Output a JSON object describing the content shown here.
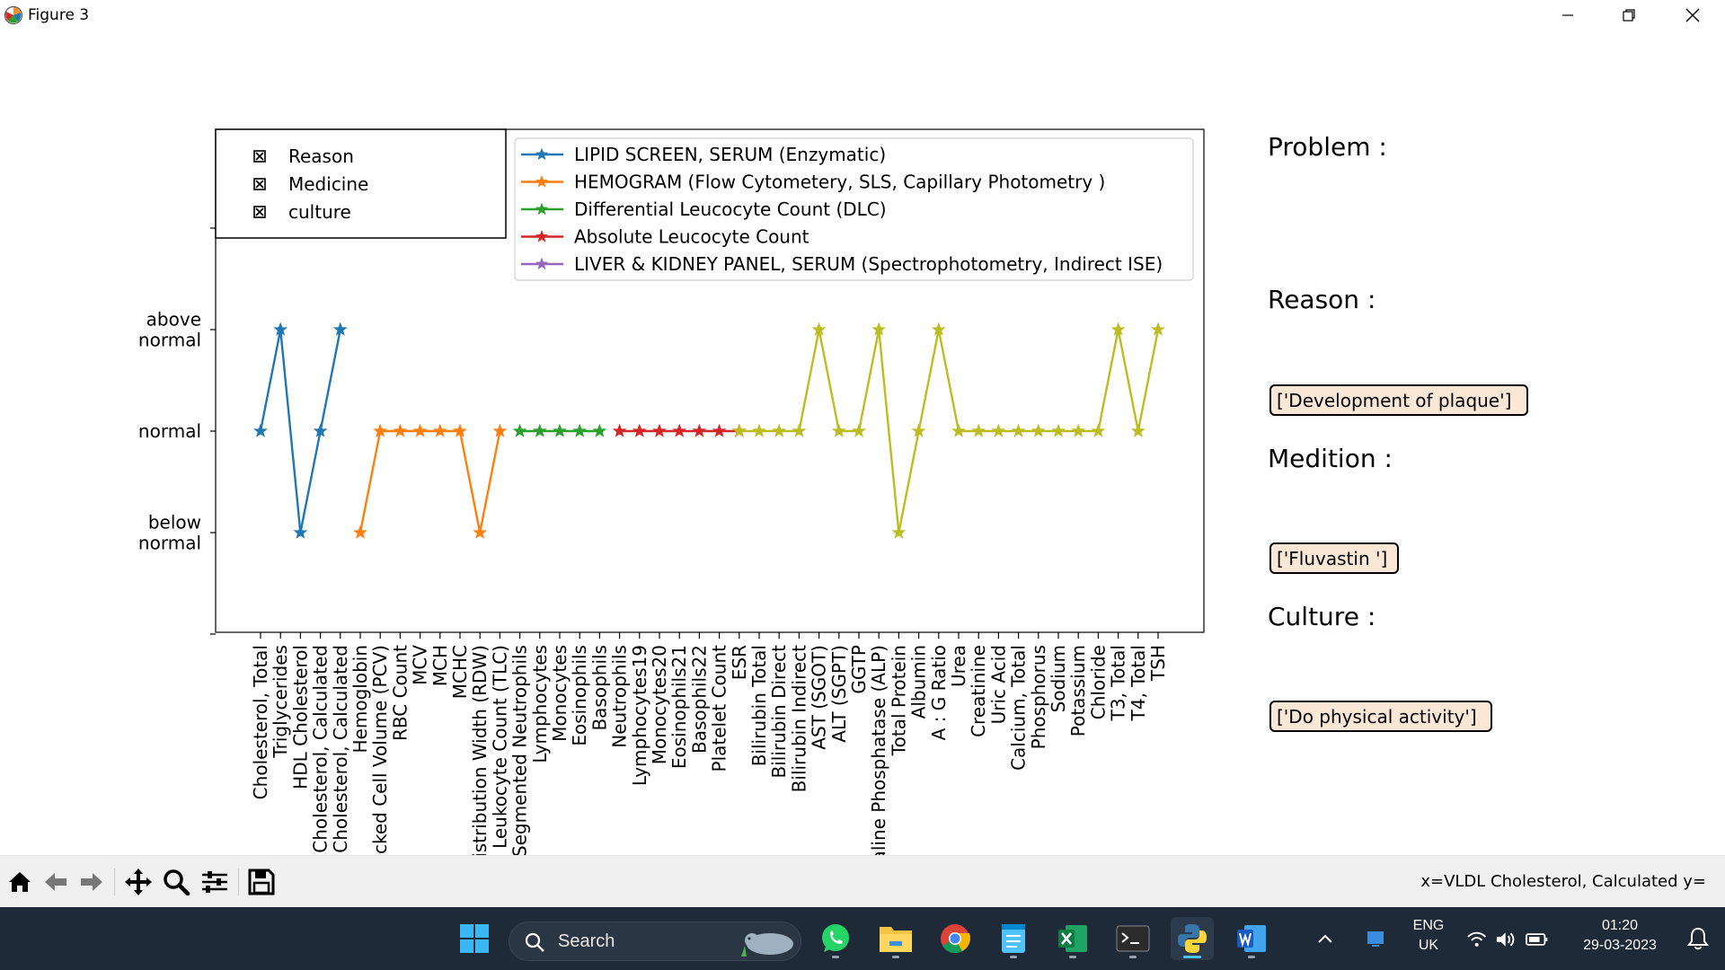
{
  "window": {
    "title": "Figure 3"
  },
  "chart_data": {
    "type": "line",
    "ylim": [
      -2,
      2
    ],
    "y_ticks": [
      {
        "value": -1,
        "label": "below\nnormal"
      },
      {
        "value": 0,
        "label": "normal"
      },
      {
        "value": 1,
        "label": "above\nnormal"
      }
    ],
    "categories": [
      "Cholesterol, Total",
      "Triglycerides",
      "HDL Cholesterol",
      "LDL Cholesterol, Calculated",
      "VLDL Cholesterol, Calculated",
      "Hemoglobin",
      "Packed Cell Volume (PCV)",
      "RBC Count",
      "MCV",
      "MCH",
      "MCHC",
      "Red Cell Distribution Width (RDW)",
      "Total Leukocyte Count (TLC)",
      "Segmented Neutrophils",
      "Lymphocytes",
      "Monocytes",
      "Eosinophils",
      "Basophils",
      "Neutrophils",
      "Lymphocytes19",
      "Monocytes20",
      "Eosinophils21",
      "Basophils22",
      "Platelet Count",
      "ESR",
      "Bilirubin Total",
      "Bilirubin Direct",
      "Bilirubin Indirect",
      "AST (SGOT)",
      "ALT (SGPT)",
      "GGTP",
      "Alkaline Phosphatase (ALP)",
      "Total Protein",
      "Albumin",
      "A : G Ratio",
      "Urea",
      "Creatinine",
      "Uric Acid",
      "Calcium, Total",
      "Phosphorus",
      "Sodium",
      "Potassium",
      "Chloride",
      "T3, Total",
      "T4, Total",
      "TSH"
    ],
    "series": [
      {
        "name": "LIPID SCREEN, SERUM (Enzymatic)",
        "color": "#1f77b4",
        "start": 0,
        "values": [
          0,
          1,
          -1,
          0,
          1
        ]
      },
      {
        "name": "HEMOGRAM (Flow Cytometery, SLS, Capillary Photometry )",
        "color": "#ff7f0e",
        "start": 5,
        "values": [
          -1,
          0,
          0,
          0,
          0,
          0,
          -1,
          0
        ]
      },
      {
        "name": "Differential Leucocyte Count (DLC)",
        "color": "#2ca02c",
        "start": 13,
        "values": [
          0,
          0,
          0,
          0,
          0
        ]
      },
      {
        "name": "Absolute Leucocyte Count",
        "color": "#d62728",
        "start": 18,
        "values": [
          0,
          0,
          0,
          0,
          0,
          0,
          0
        ]
      },
      {
        "name": "LIVER & KIDNEY PANEL, SERUM (Spectrophotometry, Indirect ISE)",
        "color": "#9467bd",
        "start": 25,
        "values": []
      },
      {
        "name": "",
        "color": "#bcbd22",
        "start": 24,
        "values": [
          0,
          0,
          0,
          0,
          1,
          0,
          0,
          1,
          -1,
          0,
          1,
          0,
          0,
          0,
          0,
          0,
          0,
          0,
          0,
          1,
          0,
          1
        ]
      }
    ],
    "legend_box": [
      "Reason",
      "Medicine",
      "culture"
    ],
    "legend_placement": "top"
  },
  "side_panel": {
    "problem_label": "Problem :",
    "reason_label": "Reason :",
    "reason_value": "['Development of plaque']",
    "medicine_label": "Medition :",
    "medicine_value": "['Fluvastin ']",
    "culture_label": "Culture :",
    "culture_value": "['Do physical activity']"
  },
  "toolbar": {
    "coord_readout": "x=VLDL Cholesterol, Calculated y="
  },
  "taskbar": {
    "search_label": "Search",
    "lang_line1": "ENG",
    "lang_line2": "UK",
    "time": "01:20",
    "date": "29-03-2023"
  }
}
